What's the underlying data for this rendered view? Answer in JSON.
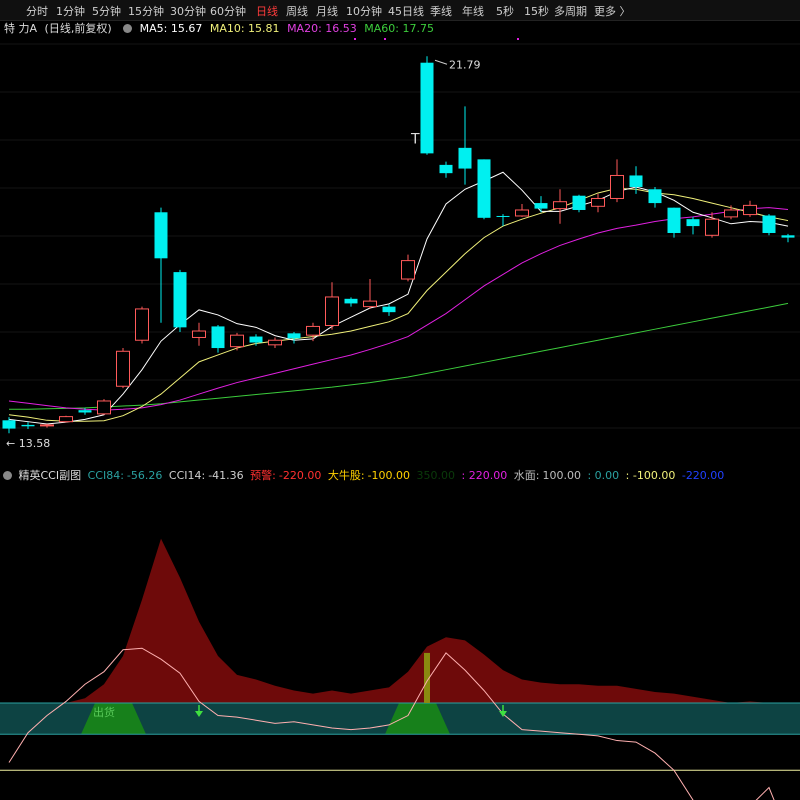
{
  "tabs": [
    {
      "label": "分时",
      "active": false
    },
    {
      "label": "1分钟",
      "active": false
    },
    {
      "label": "5分钟",
      "active": false
    },
    {
      "label": "15分钟",
      "active": false
    },
    {
      "label": "30分钟",
      "active": false
    },
    {
      "label": "60分钟",
      "active": false
    },
    {
      "label": "日线",
      "active": true
    },
    {
      "label": "周线",
      "active": false
    },
    {
      "label": "月线",
      "active": false
    },
    {
      "label": "10分钟",
      "active": false
    },
    {
      "label": "45日线",
      "active": false
    },
    {
      "label": "季线",
      "active": false
    },
    {
      "label": "年线",
      "active": false
    },
    {
      "label": "5秒",
      "active": false
    },
    {
      "label": "15秒",
      "active": false
    },
    {
      "label": "多周期",
      "active": false
    },
    {
      "label": "更多 〉",
      "active": false
    }
  ],
  "info": {
    "stock_name": "特 力A",
    "period": "(日线,前复权)",
    "ma5": "MA5: 15.67",
    "ma10": "MA10: 15.81",
    "ma20": "MA20: 16.53",
    "ma60": "MA60: 17.75"
  },
  "colors": {
    "up": "#ff5a5a",
    "down": "#00f0f0",
    "ma5": "#ffffff",
    "ma10": "#f0f07a",
    "ma20": "#e020e0",
    "ma60": "#3ccc3c",
    "cci_fill": "#6e0a0a",
    "cci_line": "#ffb0b0",
    "green_fill": "#17801b",
    "teal_fill": "#0e4a4a",
    "yellow_line": "#f0f0a0"
  },
  "main_chart": {
    "price_max_label": "21.79",
    "price_min_label": "13.58",
    "marker_T": "T",
    "candles": [
      [
        13.88,
        13.7,
        13.95,
        13.6
      ],
      [
        13.78,
        13.75,
        13.84,
        13.69
      ],
      [
        13.77,
        13.78,
        13.8,
        13.72
      ],
      [
        13.85,
        13.96,
        13.98,
        13.83
      ],
      [
        14.1,
        14.05,
        14.15,
        14.0
      ],
      [
        14.02,
        14.3,
        14.34,
        14.0
      ],
      [
        14.62,
        15.38,
        15.45,
        14.58
      ],
      [
        15.62,
        16.3,
        16.35,
        15.55
      ],
      [
        18.4,
        17.4,
        18.5,
        16.0
      ],
      [
        17.1,
        15.9,
        17.15,
        15.8
      ],
      [
        15.68,
        15.82,
        16.0,
        15.5
      ],
      [
        15.92,
        15.45,
        15.95,
        15.35
      ],
      [
        15.48,
        15.73,
        15.78,
        15.4
      ],
      [
        15.7,
        15.57,
        15.75,
        15.5
      ],
      [
        15.52,
        15.62,
        15.68,
        15.45
      ],
      [
        15.77,
        15.66,
        15.8,
        15.55
      ],
      [
        15.73,
        15.92,
        16.0,
        15.6
      ],
      [
        15.94,
        16.56,
        16.88,
        15.85
      ],
      [
        16.52,
        16.42,
        16.55,
        16.35
      ],
      [
        16.35,
        16.47,
        16.95,
        16.3
      ],
      [
        16.35,
        16.23,
        16.4,
        16.15
      ],
      [
        16.95,
        17.35,
        17.48,
        16.9
      ],
      [
        21.65,
        19.68,
        21.79,
        19.65
      ],
      [
        19.43,
        19.25,
        19.5,
        19.15
      ],
      [
        19.8,
        19.35,
        20.7,
        19.0
      ],
      [
        19.55,
        18.28,
        19.55,
        18.25
      ],
      [
        18.32,
        18.3,
        18.36,
        18.1
      ],
      [
        18.32,
        18.45,
        18.58,
        18.3
      ],
      [
        18.6,
        18.48,
        18.75,
        18.4
      ],
      [
        18.48,
        18.63,
        18.9,
        18.15
      ],
      [
        18.76,
        18.45,
        18.78,
        18.4
      ],
      [
        18.53,
        18.7,
        18.8,
        18.4
      ],
      [
        18.7,
        19.2,
        19.55,
        18.62
      ],
      [
        19.2,
        18.95,
        19.4,
        18.8
      ],
      [
        18.9,
        18.6,
        18.95,
        18.5
      ],
      [
        18.5,
        17.95,
        18.5,
        17.85
      ],
      [
        18.25,
        18.1,
        18.3,
        17.92
      ],
      [
        17.9,
        18.25,
        18.4,
        17.85
      ],
      [
        18.3,
        18.45,
        18.55,
        18.25
      ],
      [
        18.35,
        18.55,
        18.65,
        18.3
      ],
      [
        18.33,
        17.95,
        18.36,
        17.9
      ],
      [
        17.9,
        17.85,
        17.93,
        17.75
      ]
    ],
    "ma5": [
      13.9,
      13.85,
      13.8,
      13.84,
      13.9,
      14.0,
      14.45,
      14.98,
      15.6,
      15.96,
      16.28,
      16.17,
      15.98,
      15.9,
      15.72,
      15.62,
      15.65,
      15.92,
      16.12,
      16.32,
      16.41,
      16.62,
      17.82,
      18.58,
      18.9,
      19.08,
      19.27,
      18.88,
      18.42,
      18.42,
      18.54,
      18.66,
      18.85,
      18.95,
      18.84,
      18.66,
      18.4,
      18.28,
      18.15,
      18.2,
      18.18,
      18.1
    ],
    "ma10": [
      14.0,
      13.95,
      13.88,
      13.86,
      13.86,
      13.87,
      13.98,
      14.18,
      14.45,
      14.8,
      15.15,
      15.3,
      15.45,
      15.55,
      15.6,
      15.65,
      15.7,
      15.75,
      15.82,
      15.92,
      16.02,
      16.2,
      16.7,
      17.1,
      17.5,
      17.85,
      18.1,
      18.25,
      18.38,
      18.5,
      18.66,
      18.82,
      18.92,
      18.9,
      18.82,
      18.78,
      18.7,
      18.6,
      18.5,
      18.4,
      18.3,
      18.22
    ],
    "ma20": [
      14.3,
      14.25,
      14.2,
      14.15,
      14.12,
      14.1,
      14.12,
      14.15,
      14.22,
      14.32,
      14.45,
      14.58,
      14.7,
      14.8,
      14.9,
      15.0,
      15.1,
      15.2,
      15.3,
      15.42,
      15.55,
      15.7,
      15.95,
      16.2,
      16.5,
      16.8,
      17.05,
      17.3,
      17.5,
      17.68,
      17.82,
      17.95,
      18.05,
      18.12,
      18.2,
      18.26,
      18.3,
      18.36,
      18.42,
      18.48,
      18.5,
      18.46
    ],
    "ma60": [
      14.12,
      14.12,
      14.13,
      14.14,
      14.15,
      14.17,
      14.19,
      14.21,
      14.24,
      14.28,
      14.32,
      14.36,
      14.4,
      14.44,
      14.48,
      14.52,
      14.56,
      14.6,
      14.65,
      14.7,
      14.76,
      14.82,
      14.9,
      14.98,
      15.06,
      15.14,
      15.22,
      15.3,
      15.38,
      15.46,
      15.54,
      15.62,
      15.7,
      15.78,
      15.86,
      15.94,
      16.02,
      16.1,
      16.18,
      16.26,
      16.34,
      16.42
    ]
  },
  "cci_panel": {
    "title": "精英CCI副图",
    "cci84_label": "CCI84:",
    "cci84_value": "-56.26",
    "cci14_label": "CCI14:",
    "cci14_value": "-41.36",
    "warn_label": "预警:",
    "warn_value": "-220.00",
    "bull_label": "大牛股:",
    "bull_value": "-100.00",
    "hidden_value": "350.00",
    "magenta_value": ": 220.00",
    "water_label": "水面:",
    "water_value": "100.00",
    "zero_value": ": 0.00",
    "neg100_value": ": -100.00",
    "neg220_value": "-220.00",
    "exit_label": "出货",
    "cci84_area": [
      -100,
      -55,
      -45,
      -20,
      15,
      60,
      150,
      330,
      525,
      400,
      260,
      150,
      90,
      75,
      55,
      40,
      30,
      40,
      30,
      40,
      50,
      100,
      180,
      210,
      200,
      155,
      105,
      75,
      65,
      60,
      60,
      55,
      55,
      45,
      35,
      30,
      20,
      10,
      0,
      5,
      0,
      0
    ],
    "cci14_line": [
      -190,
      -95,
      -40,
      5,
      60,
      100,
      170,
      175,
      140,
      95,
      5,
      -40,
      -45,
      -55,
      -65,
      -60,
      -70,
      -80,
      -85,
      -80,
      -70,
      -40,
      70,
      160,
      105,
      40,
      -35,
      -85,
      -90,
      -95,
      -100,
      -105,
      -120,
      -125,
      -160,
      -215,
      -310,
      -400,
      -360,
      -330,
      -270,
      -420
    ],
    "green_start": [
      [
        4,
        7
      ],
      [
        20,
        23
      ]
    ],
    "bars": [
      [
        22,
        160
      ]
    ],
    "arrows": [
      10,
      26
    ]
  }
}
